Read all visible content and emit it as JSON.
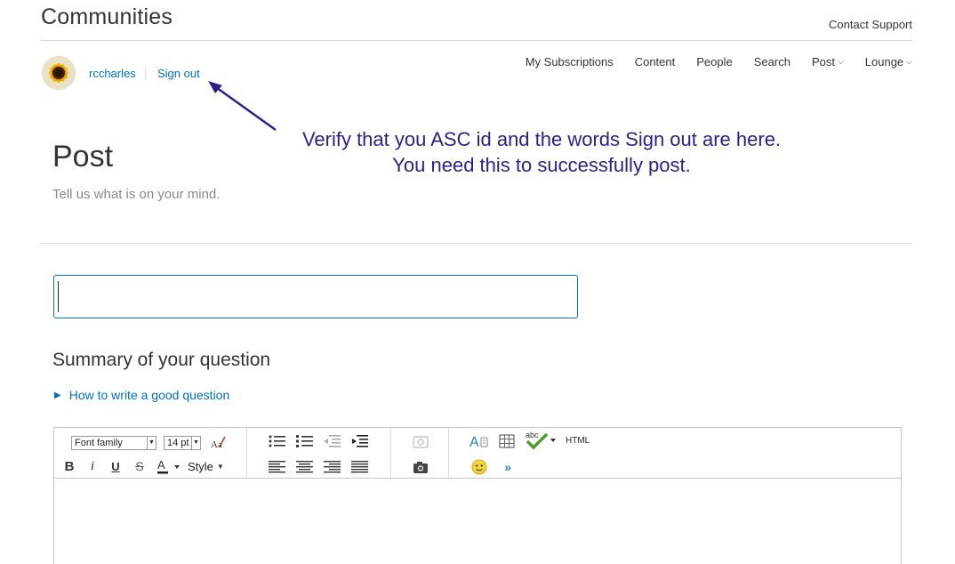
{
  "header": {
    "site_title": "Communities",
    "contact_link": "Contact Support"
  },
  "user": {
    "username": "rccharles",
    "sign_out": "Sign out"
  },
  "nav": {
    "items": [
      {
        "label": "My Subscriptions",
        "has_dropdown": false
      },
      {
        "label": "Content",
        "has_dropdown": false
      },
      {
        "label": "People",
        "has_dropdown": false
      },
      {
        "label": "Search",
        "has_dropdown": false
      },
      {
        "label": "Post",
        "has_dropdown": true
      },
      {
        "label": "Lounge",
        "has_dropdown": true
      }
    ],
    "dropdown_chevron": "⌵"
  },
  "annotation": {
    "line1": "Verify that you ASC id and the words Sign out are here.",
    "line2": "You need this to successfully post.",
    "color": "#2b1f8e"
  },
  "page": {
    "title": "Post",
    "subtitle": "Tell us what is on your mind."
  },
  "form": {
    "subject_value": "",
    "section_heading": "Summary of your question",
    "howto_link": "How to write a good question"
  },
  "editor": {
    "font_family": "Font family",
    "font_size": "14 pt",
    "style_label": "Style",
    "html_label": "HTML",
    "spell_label": "abc",
    "icons": [
      "clear-format-icon",
      "bold-icon",
      "italic-icon",
      "underline-icon",
      "strikethrough-icon",
      "font-color-icon",
      "bulleted-list-icon",
      "numbered-list-icon",
      "outdent-icon",
      "indent-icon",
      "align-left-icon",
      "align-center-icon",
      "align-right-icon",
      "align-justify-icon",
      "insert-video-icon",
      "insert-image-icon",
      "text-style-icon",
      "table-icon",
      "spellcheck-icon",
      "emoticon-icon",
      "more-icon"
    ]
  },
  "colors": {
    "link": "#0070c9",
    "text": "#333333",
    "rule": "#d6d6d6"
  }
}
